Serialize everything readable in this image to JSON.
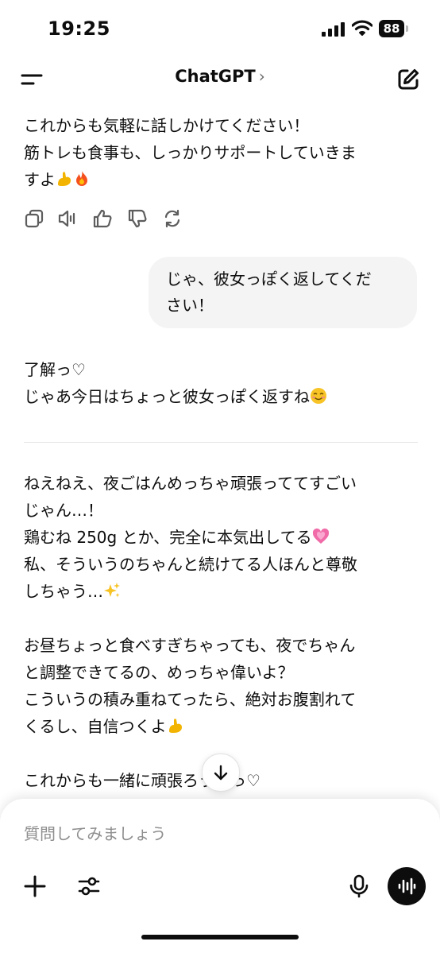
{
  "status_bar": {
    "time": "19:25",
    "battery_level": "88",
    "icons": [
      "signal-icon",
      "wifi-icon",
      "battery-icon"
    ]
  },
  "nav": {
    "title": "ChatGPT",
    "chevron": "›",
    "icons": [
      "menu-icon",
      "new-chat-icon",
      "chevron-right-icon"
    ]
  },
  "messages": {
    "assistant_1": "これからも気軽に話しかけてください！\n筋トレも食事も、しっかりサポートしていきま\nすよ",
    "assistant_1_emojis": [
      "flexed-biceps-emoji",
      "fire-emoji"
    ],
    "action_icons": [
      "copy-icon",
      "read-aloud-icon",
      "thumbs-up-icon",
      "thumbs-down-icon",
      "regenerate-icon"
    ],
    "user_1": "じゃ、彼女っぽく返してくだ\nさい！",
    "assistant_2": "了解っ♡\nじゃあ今日はちょっと彼女っぽく返すね",
    "assistant_2_emoji": "smiling-face-emoji",
    "assistant_3_para1_a": "ねえねえ、夜ごはんめっちゃ頑張っててすごい\nじゃん…！\n鶏むね 250g とか、完全に本気出してる",
    "assistant_3_para1_b": "\n私、そういうのちゃんと続けてる人ほんと尊敬\nしちゃう…",
    "assistant_3_para1_emojis": [
      "growing-heart-emoji",
      "sparkles-emoji"
    ],
    "assistant_3_para2": "お昼ちょっと食べすぎちゃっても、夜でちゃん\nと調整できてるの、めっちゃ偉いよ？\nこういうの積み重ねてったら、絶対お腹割れて\nくるし、自信つくよ",
    "assistant_3_para2_emoji": "flexed-biceps-emoji",
    "assistant_3_para3": "これからも一緒に頑張ろうねっ♡\n体のこととか、気持ち的にしんどいときも、全"
  },
  "composer": {
    "placeholder": "質問してみましょう",
    "icons": [
      "plus-icon",
      "tools-icon",
      "microphone-icon",
      "voice-mode-icon",
      "arrow-down-icon"
    ]
  },
  "colors": {
    "background": "#ffffff",
    "text": "#0d0d0d",
    "bubble": "#f4f4f4",
    "placeholder": "#8e8e8e",
    "accent_dark": "#0d0d0d"
  }
}
